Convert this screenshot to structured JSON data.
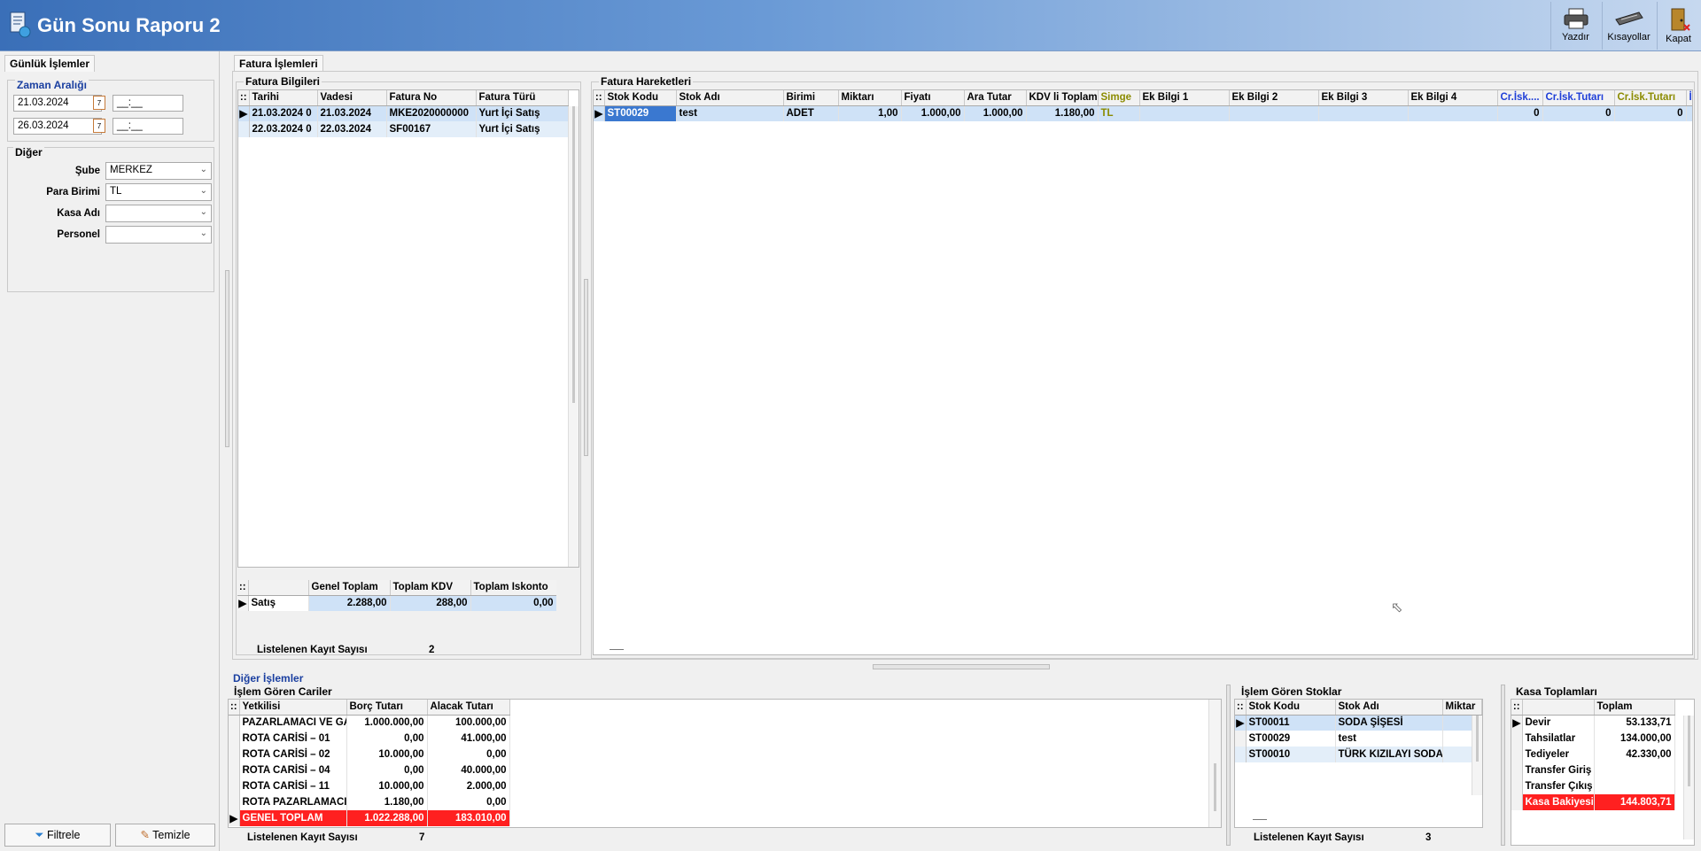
{
  "window": {
    "title": "Gün Sonu Raporu 2"
  },
  "toolbar": {
    "print_label": "Yazdır",
    "shortcuts_label": "Kısayollar",
    "close_label": "Kapat"
  },
  "left_panel": {
    "tab": "Günlük İşlemler",
    "date_range_title": "Zaman Aralığı",
    "start_date": "21.03.2024",
    "start_time": "__:__",
    "end_date": "26.03.2024",
    "end_time": "__:__",
    "other_title": "Diğer",
    "branch_label": "Şube",
    "branch_value": "MERKEZ",
    "currency_label": "Para Birimi",
    "currency_value": "TL",
    "cash_label": "Kasa Adı",
    "cash_value": "",
    "staff_label": "Personel",
    "staff_value": "",
    "filter_button": "Filtrele",
    "clear_button": "Temizle"
  },
  "main_tab": "Fatura İşlemleri",
  "invoice_info": {
    "title": "Fatura Bilgileri",
    "columns": [
      "Tarihi",
      "Vadesi",
      "Fatura No",
      "Fatura Türü"
    ],
    "rows": [
      [
        "21.03.2024 0",
        "21.03.2024",
        "MKE2020000000",
        "Yurt İçi Satış"
      ],
      [
        "22.03.2024 0",
        "22.03.2024",
        "SF00167",
        "Yurt İçi Satış"
      ]
    ],
    "summary_columns": [
      "Genel Toplam",
      "Toplam KDV",
      "Toplam Iskonto"
    ],
    "summary_rows": [
      [
        "Satış",
        "2.288,00",
        "288,00",
        "0,00"
      ]
    ],
    "count_label": "Listelenen Kayıt Sayısı",
    "count_value": "2"
  },
  "invoice_lines": {
    "title": "Fatura Hareketleri",
    "columns": [
      "Stok Kodu",
      "Stok Adı",
      "Birimi",
      "Miktarı",
      "Fiyatı",
      "Ara Tutar",
      "KDV li Toplam",
      "Simge",
      "Ek Bilgi 1",
      "Ek Bilgi 2",
      "Ek Bilgi 3",
      "Ek Bilgi 4",
      "Cr.İsk....",
      "Cr.İsk.Tutarı",
      "Cr.İsk.Tutarı",
      "İ"
    ],
    "rows": [
      [
        "ST00029",
        "test",
        "ADET",
        "1,00",
        "1.000,00",
        "1.000,00",
        "1.180,00",
        "TL",
        "",
        "",
        "",
        "",
        "0",
        "0",
        "0",
        ""
      ]
    ]
  },
  "other_ops": {
    "title": "Diğer İşlemler",
    "accounts": {
      "title": "İşlem Gören Cariler",
      "columns": [
        "Yetkilisi",
        "Borç Tutarı",
        "Alacak Tutarı"
      ],
      "rows": [
        [
          "PAZARLAMACI VE GA",
          "1.000.000,00",
          "100.000,00"
        ],
        [
          "ROTA CARİSİ – 01",
          "0,00",
          "41.000,00"
        ],
        [
          "ROTA CARİSİ – 02",
          "10.000,00",
          "0,00"
        ],
        [
          "ROTA CARİSİ – 04",
          "0,00",
          "40.000,00"
        ],
        [
          "ROTA CARİSİ – 11",
          "10.000,00",
          "2.000,00"
        ],
        [
          "ROTA PAZARLAMACI",
          "1.180,00",
          "0,00"
        ]
      ],
      "total": [
        "GENEL TOPLAM",
        "1.022.288,00",
        "183.010,00"
      ],
      "count_label": "Listelenen Kayıt Sayısı",
      "count_value": "7"
    },
    "stocks": {
      "title": "İşlem Gören Stoklar",
      "columns": [
        "Stok Kodu",
        "Stok Adı",
        "Miktar"
      ],
      "rows": [
        [
          "ST00011",
          "SODA ŞİŞESİ",
          ""
        ],
        [
          "ST00029",
          "test",
          ""
        ],
        [
          "ST00010",
          "TÜRK KIZILAYI SODA",
          ""
        ]
      ],
      "count_label": "Listelenen Kayıt Sayısı",
      "count_value": "3"
    },
    "cash_totals": {
      "title": "Kasa Toplamları",
      "columns": [
        "",
        "Toplam"
      ],
      "rows": [
        [
          "Devir",
          "53.133,71"
        ],
        [
          "Tahsilatlar",
          "134.000,00"
        ],
        [
          "Tediyeler",
          "42.330,00"
        ],
        [
          "Transfer Giriş",
          ""
        ],
        [
          "Transfer Çıkış",
          ""
        ]
      ],
      "balance": [
        "Kasa Bakiyesi",
        "144.803,71"
      ]
    }
  }
}
